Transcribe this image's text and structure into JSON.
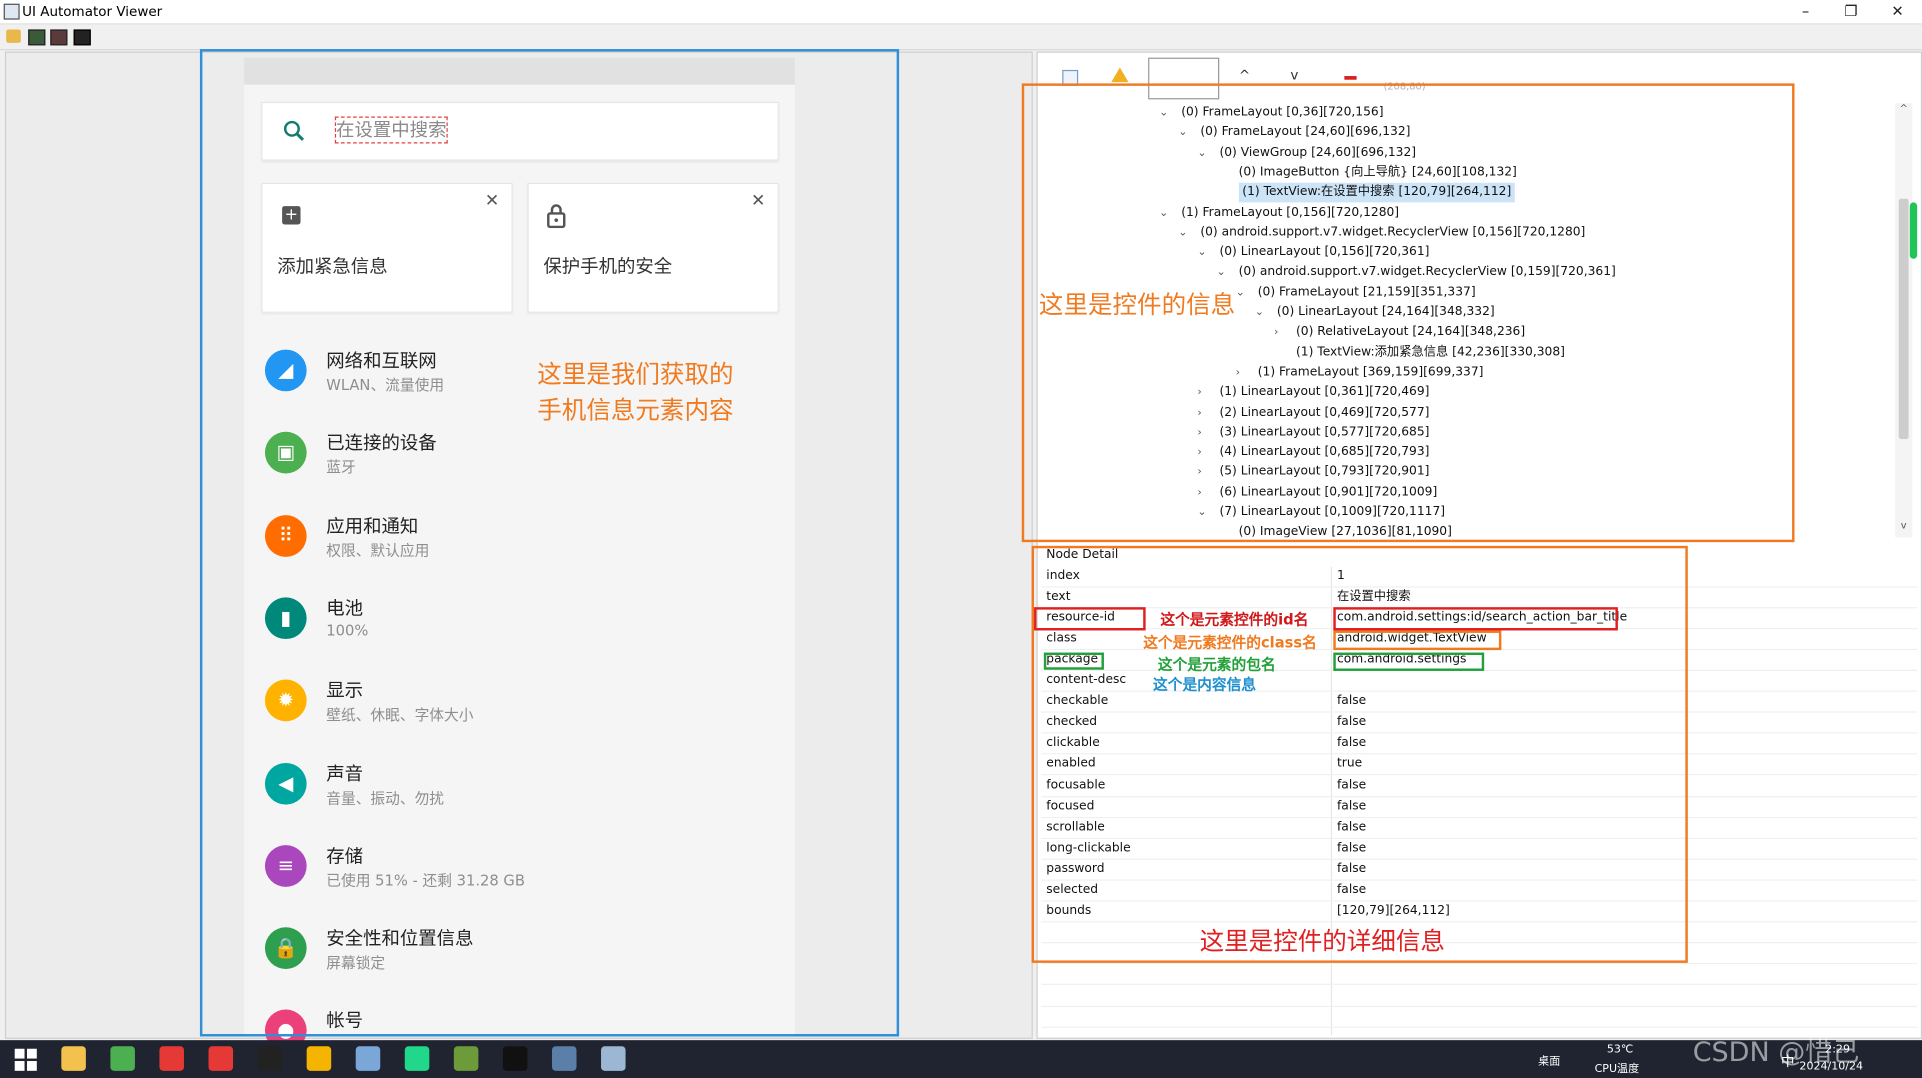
{
  "window": {
    "title": "UI Automator Viewer",
    "min": "–",
    "max": "❐",
    "close": "✕"
  },
  "toolbar": {
    "icons": [
      "open-folder-icon",
      "device-screenshot-icon",
      "device-screenshot-compressed-icon",
      "save-icon"
    ]
  },
  "phone": {
    "search_placeholder": "在设置中搜索",
    "cards": [
      {
        "label": "添加紧急信息",
        "icon": "add-box-icon",
        "close": "✕"
      },
      {
        "label": "保护手机的安全",
        "icon": "lock-icon",
        "close": "✕"
      }
    ],
    "items": [
      {
        "title": "网络和互联网",
        "subtitle": "WLAN、流量使用",
        "color": "#2196f3",
        "icon": "wifi-icon",
        "glyph": "◢"
      },
      {
        "title": "已连接的设备",
        "subtitle": "蓝牙",
        "color": "#4caf50",
        "icon": "devices-icon",
        "glyph": "▣"
      },
      {
        "title": "应用和通知",
        "subtitle": "权限、默认应用",
        "color": "#ff6d00",
        "icon": "apps-icon",
        "glyph": "⠿"
      },
      {
        "title": "电池",
        "subtitle": "100%",
        "color": "#00897b",
        "icon": "battery-icon",
        "glyph": "▮"
      },
      {
        "title": "显示",
        "subtitle": "壁纸、休眠、字体大小",
        "color": "#ffb300",
        "icon": "display-icon",
        "glyph": "✹"
      },
      {
        "title": "声音",
        "subtitle": "音量、振动、勿扰",
        "color": "#00a7a0",
        "icon": "sound-icon",
        "glyph": "◀"
      },
      {
        "title": "存储",
        "subtitle": "已使用 51% - 还剩 31.28 GB",
        "color": "#ab47bc",
        "icon": "storage-icon",
        "glyph": "≡"
      },
      {
        "title": "安全性和位置信息",
        "subtitle": "屏幕锁定",
        "color": "#2e9e4f",
        "icon": "security-icon",
        "glyph": "🔒"
      },
      {
        "title": "帐号",
        "subtitle": "",
        "color": "#ec407a",
        "icon": "account-icon",
        "glyph": "●"
      }
    ],
    "annotation": "这里是我们获取的\n手机信息元素内容"
  },
  "tree_toolbar": {
    "coords": "(208,80)"
  },
  "tree": [
    {
      "indent": 0,
      "arrow": "v",
      "text": "(0) FrameLayout [0,36][720,156]"
    },
    {
      "indent": 1,
      "arrow": "v",
      "text": "(0) FrameLayout [24,60][696,132]"
    },
    {
      "indent": 2,
      "arrow": "v",
      "text": "(0) ViewGroup [24,60][696,132]"
    },
    {
      "indent": 3,
      "arrow": "",
      "text": "(0) ImageButton {向上导航} [24,60][108,132]"
    },
    {
      "indent": 3,
      "arrow": "",
      "text": "(1) TextView:在设置中搜索 [120,79][264,112]",
      "selected": true
    },
    {
      "indent": 0,
      "arrow": "v",
      "text": "(1) FrameLayout [0,156][720,1280]"
    },
    {
      "indent": 1,
      "arrow": "v",
      "text": "(0) android.support.v7.widget.RecyclerView [0,156][720,1280]"
    },
    {
      "indent": 2,
      "arrow": "v",
      "text": "(0) LinearLayout [0,156][720,361]"
    },
    {
      "indent": 3,
      "arrow": "v",
      "text": "(0) android.support.v7.widget.RecyclerView [0,159][720,361]"
    },
    {
      "indent": 4,
      "arrow": "v",
      "text": "(0) FrameLayout [21,159][351,337]"
    },
    {
      "indent": 5,
      "arrow": "v",
      "text": "(0) LinearLayout [24,164][348,332]"
    },
    {
      "indent": 6,
      "arrow": ">",
      "text": "(0) RelativeLayout [24,164][348,236]"
    },
    {
      "indent": 6,
      "arrow": "",
      "text": "(1) TextView:添加紧急信息 [42,236][330,308]"
    },
    {
      "indent": 4,
      "arrow": ">",
      "text": "(1) FrameLayout [369,159][699,337]"
    },
    {
      "indent": 2,
      "arrow": ">",
      "text": "(1) LinearLayout [0,361][720,469]"
    },
    {
      "indent": 2,
      "arrow": ">",
      "text": "(2) LinearLayout [0,469][720,577]"
    },
    {
      "indent": 2,
      "arrow": ">",
      "text": "(3) LinearLayout [0,577][720,685]"
    },
    {
      "indent": 2,
      "arrow": ">",
      "text": "(4) LinearLayout [0,685][720,793]"
    },
    {
      "indent": 2,
      "arrow": ">",
      "text": "(5) LinearLayout [0,793][720,901]"
    },
    {
      "indent": 2,
      "arrow": ">",
      "text": "(6) LinearLayout [0,901][720,1009]"
    },
    {
      "indent": 2,
      "arrow": "v",
      "text": "(7) LinearLayout [0,1009][720,1117]"
    },
    {
      "indent": 3,
      "arrow": "",
      "text": "(0) ImageView [27,1036][81,1090]"
    }
  ],
  "tree_annotation": "这里是控件的信息",
  "detail": {
    "header": "Node Detail",
    "rows": [
      {
        "key": "index",
        "value": "1"
      },
      {
        "key": "text",
        "value": "在设置中搜索"
      },
      {
        "key": "resource-id",
        "value": "com.android.settings:id/search_action_bar_title"
      },
      {
        "key": "class",
        "value": "android.widget.TextView"
      },
      {
        "key": "package",
        "value": "com.android.settings"
      },
      {
        "key": "content-desc",
        "value": ""
      },
      {
        "key": "checkable",
        "value": "false"
      },
      {
        "key": "checked",
        "value": "false"
      },
      {
        "key": "clickable",
        "value": "false"
      },
      {
        "key": "enabled",
        "value": "true"
      },
      {
        "key": "focusable",
        "value": "false"
      },
      {
        "key": "focused",
        "value": "false"
      },
      {
        "key": "scrollable",
        "value": "false"
      },
      {
        "key": "long-clickable",
        "value": "false"
      },
      {
        "key": "password",
        "value": "false"
      },
      {
        "key": "selected",
        "value": "false"
      },
      {
        "key": "bounds",
        "value": "[120,79][264,112]"
      }
    ],
    "note_id": "这个是元素控件的id名",
    "note_class": "这个是元素控件的class名",
    "note_package": "这个是元素的包名",
    "note_content": "这个是内容信息",
    "annotation": "这里是控件的详细信息"
  },
  "taskbar": {
    "desktop": "桌面",
    "cpu_temp": "53℃",
    "cpu_label": "CPU温度",
    "ime": "中",
    "time": "2:29",
    "date": "2024/10/24",
    "watermark": "CSDN @惜己",
    "apps": [
      "windows-start-icon",
      "file-explorer-icon",
      "browser-icon",
      "wps-icon",
      "netease-music-icon",
      "typora-icon",
      "color-app-icon",
      "remote-desktop-icon",
      "pycharm-icon",
      "tool-icon",
      "terminal-icon",
      "uiautomator-icon",
      "paint-icon"
    ]
  }
}
